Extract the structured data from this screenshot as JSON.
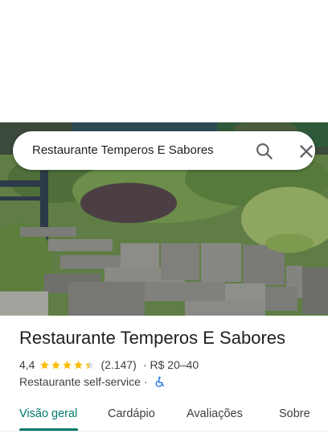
{
  "search": {
    "query": "Restaurante Temperos E Sabores",
    "search_icon": "search-icon",
    "close_icon": "close-icon"
  },
  "place": {
    "name": "Restaurante Temperos E Sabores",
    "rating": "4,4",
    "stars_filled": 4.4,
    "stars_total": 5,
    "reviews": "(2.147)",
    "separator": "·",
    "price": "R$ 20–40",
    "category": "Restaurante self-service",
    "accessibility_icon": "wheelchair-icon"
  },
  "tabs": [
    {
      "label": "Visão geral",
      "active": true
    },
    {
      "label": "Cardápio",
      "active": false
    },
    {
      "label": "Avaliações",
      "active": false
    },
    {
      "label": "Sobre",
      "active": false
    }
  ],
  "colors": {
    "accent": "#00796b",
    "star": "#fbbc04",
    "accessibility": "#1a73e8"
  }
}
